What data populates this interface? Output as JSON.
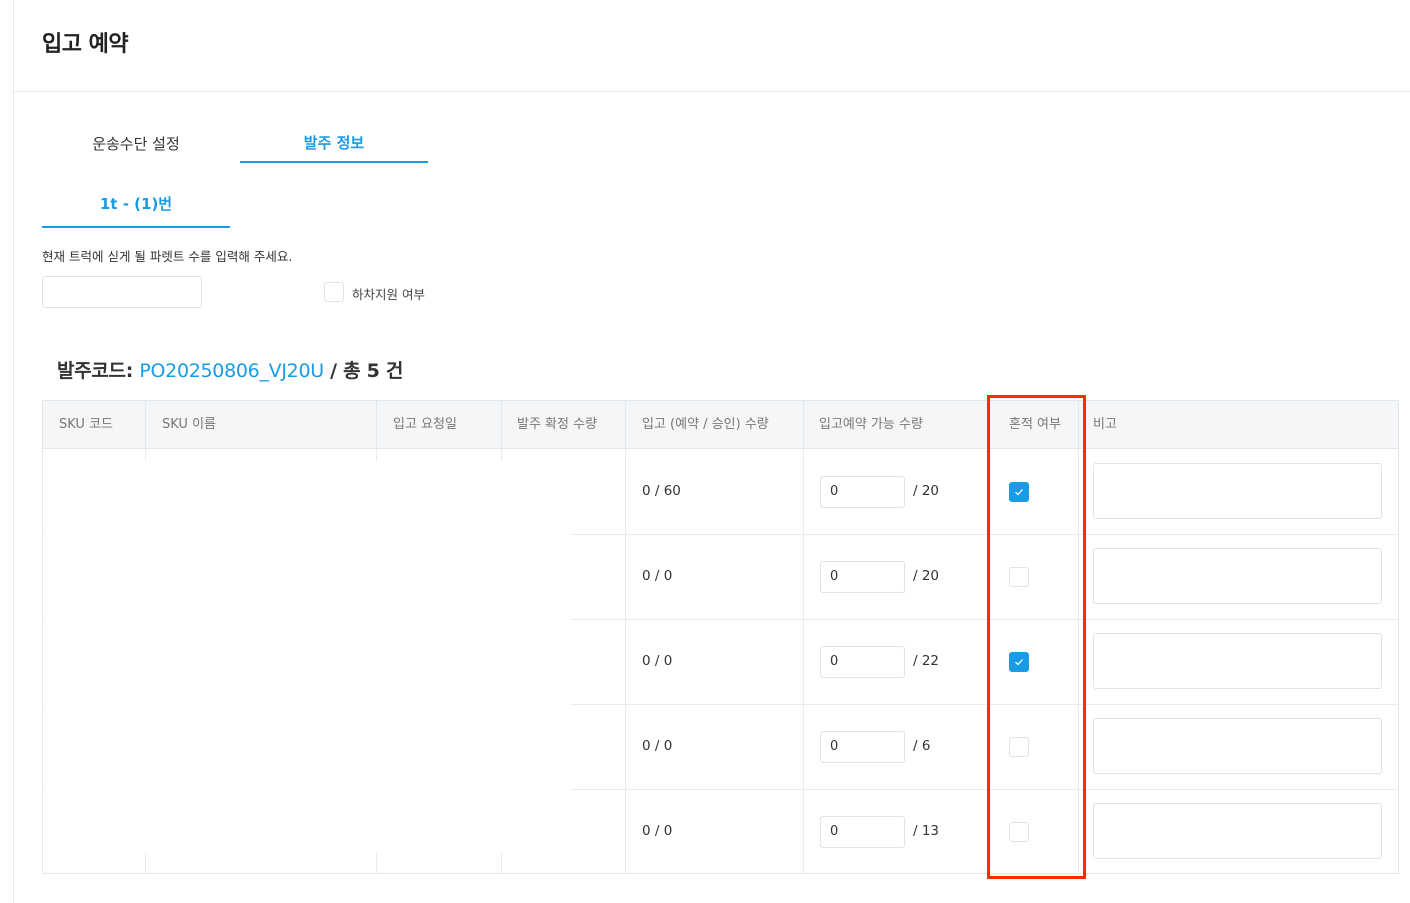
{
  "page": {
    "title": "입고 예약"
  },
  "tabs": [
    {
      "label": "운송수단 설정",
      "active": false
    },
    {
      "label": "발주 정보",
      "active": true
    }
  ],
  "truck_tab": {
    "label": "1t - (1)번"
  },
  "pallet": {
    "label": "현재 트럭에 싣게 될 파렛트 수를 입력해 주세요.",
    "value": ""
  },
  "unload_support": {
    "label": "하차지원 여부",
    "checked": false
  },
  "order": {
    "prefix": "발주코드: ",
    "code": "PO20250806_VJ20U",
    "suffix": " / 총 5 건"
  },
  "table": {
    "headers": {
      "sku_code": "SKU 코드",
      "sku_name": "SKU 이름",
      "request_date": "입고 요청일",
      "confirmed_qty": "발주 확정 수량",
      "received_qty": "입고 (예약 / 승인) 수량",
      "reservable_qty": "입고예약 가능 수량",
      "mixed": "혼적 여부",
      "note": "비고"
    },
    "rows": [
      {
        "received": "0 / 60",
        "qty_value": "0",
        "max": "/ 20",
        "mixed": true,
        "note": ""
      },
      {
        "received": "0 / 0",
        "qty_value": "0",
        "max": "/ 20",
        "mixed": false,
        "note": ""
      },
      {
        "received": "0 / 0",
        "qty_value": "0",
        "max": "/ 22",
        "mixed": true,
        "note": ""
      },
      {
        "received": "0 / 0",
        "qty_value": "0",
        "max": "/ 6",
        "mixed": false,
        "note": ""
      },
      {
        "received": "0 / 0",
        "qty_value": "0",
        "max": "/ 13",
        "mixed": false,
        "note": ""
      }
    ]
  },
  "colors": {
    "accent": "#1a9be6",
    "annotation": "#ff2a00"
  },
  "icons": {
    "check": "check-icon"
  }
}
